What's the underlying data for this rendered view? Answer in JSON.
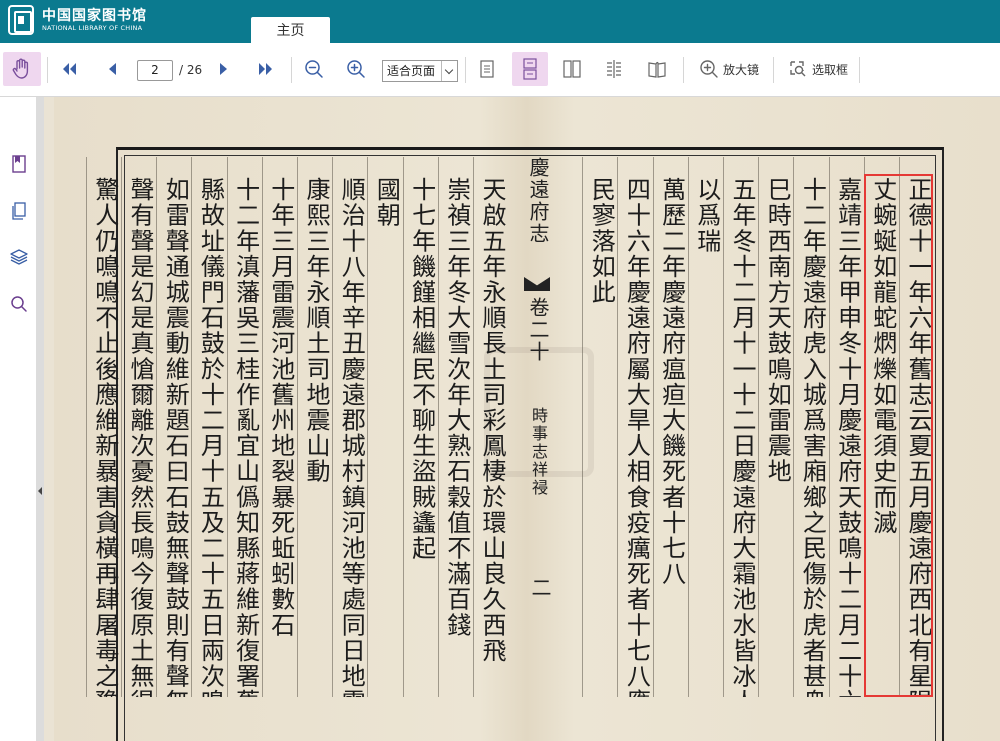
{
  "header": {
    "logo_cn": "中国国家图书馆",
    "logo_en": "NATIONAL LIBRARY OF CHINA",
    "tab_home": "主页",
    "bg_color": "#0b7a8f"
  },
  "toolbar": {
    "page_current": "2",
    "page_total": "/ 26",
    "zoom_mode": "适合页面",
    "magnifier_label": "放大镜",
    "selection_label": "选取框",
    "active_color": "#efd7ef"
  },
  "sidebar": {
    "icons": [
      "bookmark-icon",
      "pages-icon",
      "layers-icon",
      "search-icon"
    ]
  },
  "document": {
    "center_title": "慶遠府志",
    "center_volume": "卷二十",
    "center_section": "時事志祥祲",
    "center_page": "二",
    "columns": [
      "正德十一年六年舊志云夏五月慶遠府西北有星隕長五六",
      "丈蜿蜒如龍蛇熌爍如電須史而滅",
      "嘉靖三年甲申冬十月慶遠府天鼓鳴十二月二十六日",
      "十二年慶遠府虎入城爲害廂鄉之民傷於虎者甚衆",
      "巳時西南方天鼓鳴如雷震地",
      "五年冬十二月十一十二日慶遠府大霜池水皆冰人",
      "以爲瑞",
      "萬歷二年慶遠府瘟疸大饑死者十七八",
      "四十六年慶遠府屬大旱人相食疫癘死者十七八應",
      "民寥落如此",
      "天啟五年永順長土司彩鳳棲於環山良久西飛",
      "崇禎三年冬大雪次年大熟石穀值不滿百錢",
      "十七年饑饉相繼民不聊生盜賊蠭起",
      "國朝",
      "順治十八年辛丑慶遠郡城村鎮河池等處同日地震",
      "康熙三年永順土司地震山動",
      "十年三月雷震河池舊州地裂暴死蚯蚓數石",
      "十二年滇藩吳三桂作亂宜山僞知縣蔣維新復署舊",
      "縣故址儀門石鼓於十二月十五及二十五日兩次鳴",
      "如雷聲通城震動維新題石曰石鼓無聲鼓則有聲無",
      "聲有聲是幻是真愴爾離次憂然長鳴今復原土無得",
      "驚人仍鳴鳴不止後應維新暴害貪橫再肆屠毒之豫"
    ]
  }
}
